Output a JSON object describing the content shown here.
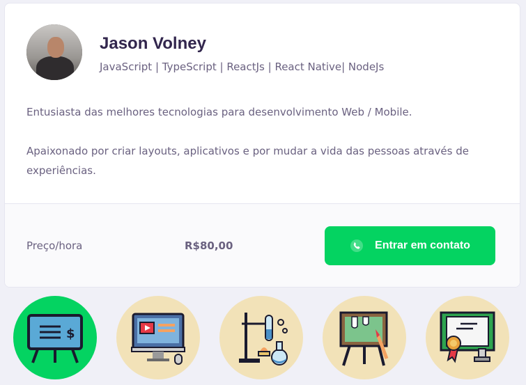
{
  "profile": {
    "name": "Jason Volney",
    "stack": "JavaScript | TypeScript | ReactJs | React Native| NodeJs",
    "bio": [
      "Entusiasta das melhores tecnologias para desenvolvimento Web / Mobile.",
      "Apaixonado por criar layouts, aplicativos e por mudar a vida das pessoas através de experiências."
    ]
  },
  "footer": {
    "price_label": "Preço/hora",
    "price_value": "R$80,00",
    "contact_label": "Entrar em contato"
  },
  "colors": {
    "accent_green": "#04d361",
    "circle_beige": "#f2e2b8",
    "title": "#32264d",
    "text": "#6a6180"
  },
  "subjects": [
    {
      "icon": "presentation-board-icon",
      "selected": true
    },
    {
      "icon": "computer-monitor-icon",
      "selected": false
    },
    {
      "icon": "chemistry-lab-icon",
      "selected": false
    },
    {
      "icon": "painting-easel-icon",
      "selected": false
    },
    {
      "icon": "certificate-icon",
      "selected": false
    }
  ]
}
